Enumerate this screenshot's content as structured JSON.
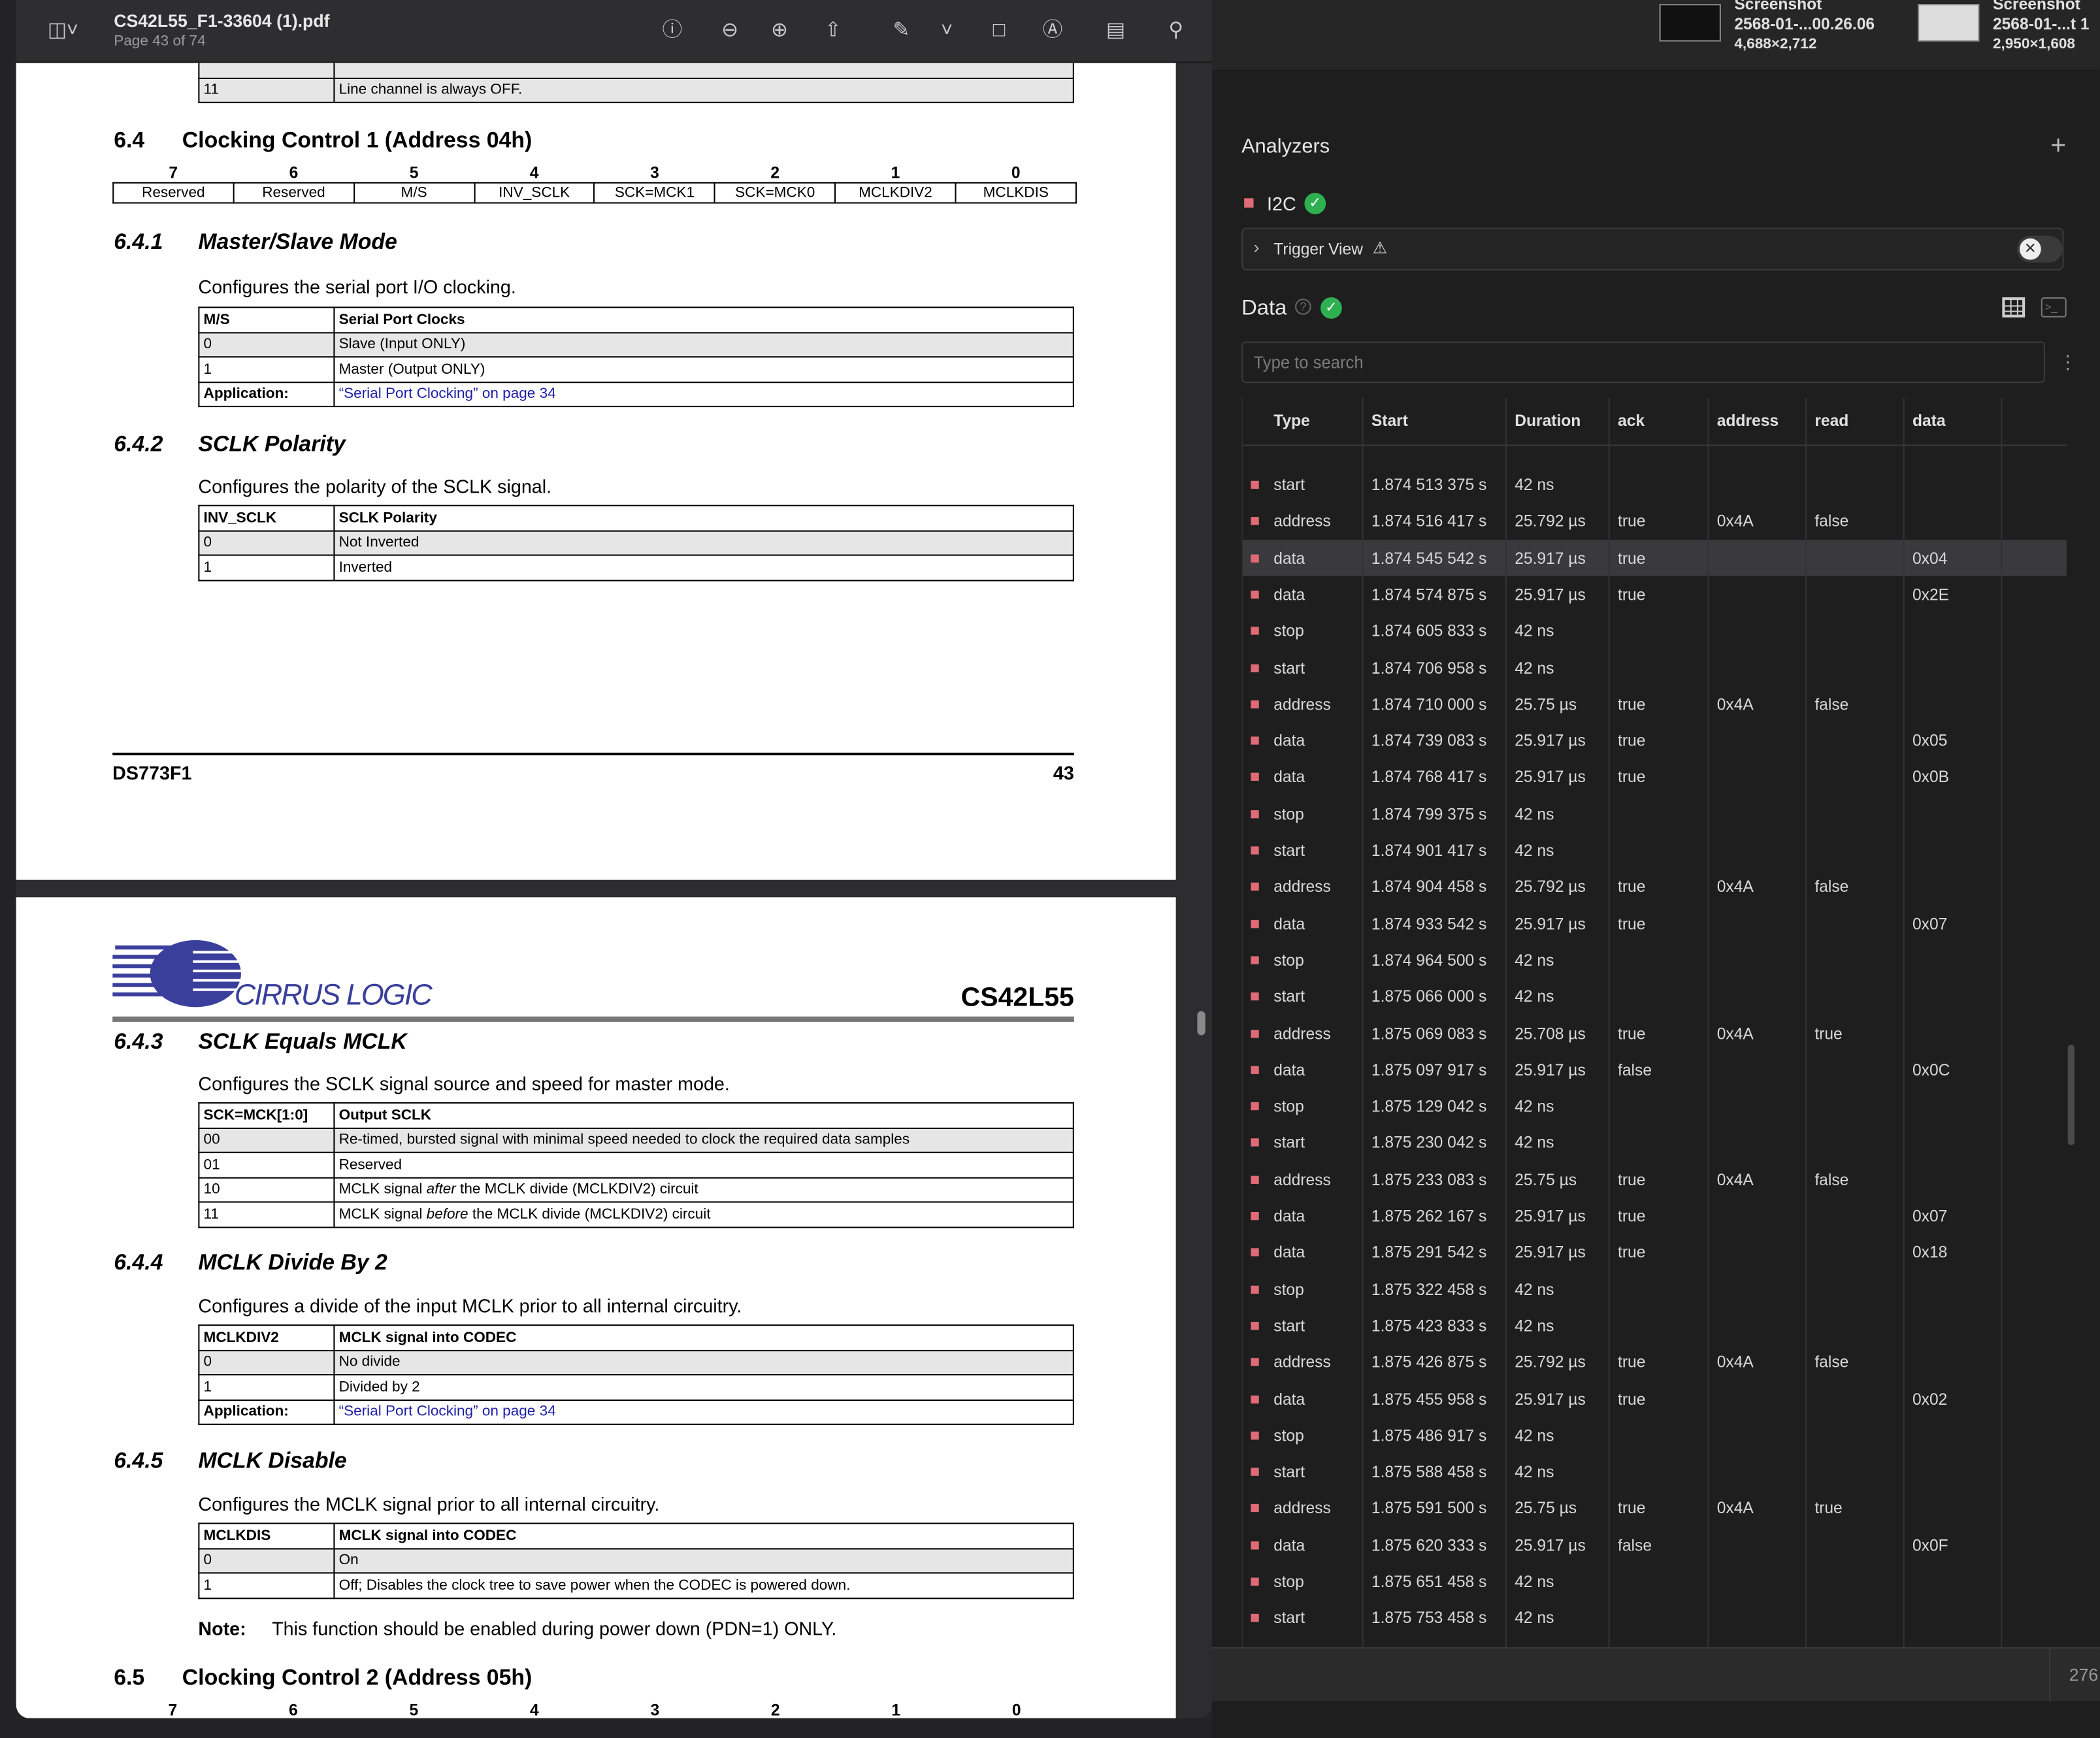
{
  "viewer": {
    "file_name": "CS42L55_F1-33604 (1).pdf",
    "page_label": "Page 43 of 74"
  },
  "pdf": {
    "top_row": {
      "code": "11",
      "text": "Line channel is always OFF."
    },
    "s64": {
      "num": "6.4",
      "title": "Clocking Control 1 (Address 04h)"
    },
    "bits": [
      "7",
      "6",
      "5",
      "4",
      "3",
      "2",
      "1",
      "0"
    ],
    "bit_names": [
      "Reserved",
      "Reserved",
      "M/S",
      "INV_SCLK",
      "SCK=MCK1",
      "SCK=MCK0",
      "MCLKDIV2",
      "MCLKDIS"
    ],
    "s641": {
      "num": "6.4.1",
      "title": "Master/Slave Mode",
      "desc": "Configures the serial port I/O clocking.",
      "h1": "M/S",
      "h2": "Serial Port Clocks",
      "rows": [
        [
          "0",
          "Slave (Input ONLY)"
        ],
        [
          "1",
          "Master (Output ONLY)"
        ]
      ],
      "app_label": "Application:",
      "app_link": "“Serial Port Clocking” on page 34"
    },
    "s642": {
      "num": "6.4.2",
      "title": "SCLK Polarity",
      "desc": "Configures the polarity of the SCLK signal.",
      "h1": "INV_SCLK",
      "h2": "SCLK Polarity",
      "rows": [
        [
          "0",
          "Not Inverted"
        ],
        [
          "1",
          "Inverted"
        ]
      ]
    },
    "footer": {
      "doc": "DS773F1",
      "page": "43"
    },
    "logo": "CIRRUS LOGIC",
    "part": "CS42L55",
    "s643": {
      "num": "6.4.3",
      "title": "SCLK Equals MCLK",
      "desc": "Configures the SCLK signal source and speed for master mode.",
      "h1": "SCK=MCK[1:0]",
      "h2": "Output SCLK",
      "rows": [
        [
          "00",
          "Re-timed, bursted signal with minimal speed needed to clock the required data samples"
        ],
        [
          "01",
          "Reserved"
        ]
      ],
      "r10": {
        "code": "10",
        "a": "MCLK signal ",
        "em": "after",
        "b": " the MCLK divide (MCLKDIV2) circuit"
      },
      "r11": {
        "code": "11",
        "a": "MCLK signal ",
        "em": "before",
        "b": " the MCLK divide (MCLKDIV2) circuit"
      }
    },
    "s644": {
      "num": "6.4.4",
      "title": "MCLK Divide By 2",
      "desc": "Configures a divide of the input MCLK prior to all internal circuitry.",
      "h1": "MCLKDIV2",
      "h2": "MCLK signal into CODEC",
      "rows": [
        [
          "0",
          "No divide"
        ],
        [
          "1",
          "Divided by 2"
        ]
      ],
      "app_label": "Application:",
      "app_link": "“Serial Port Clocking” on page 34"
    },
    "s645": {
      "num": "6.4.5",
      "title": "MCLK Disable",
      "desc": "Configures the MCLK signal prior to all internal circuitry.",
      "h1": "MCLKDIS",
      "h2": "MCLK signal into CODEC",
      "rows": [
        [
          "0",
          "On"
        ],
        [
          "1",
          "Off; Disables the clock tree to save power when the CODEC is powered down."
        ]
      ],
      "note_label": "Note:",
      "note": "This function should be enabled during power down (PDN=1) ONLY."
    },
    "s65": {
      "num": "6.5",
      "title": "Clocking Control 2 (Address 05h)"
    }
  },
  "screenshots": [
    {
      "title": "Screenshot",
      "name": "2568-01-...00.26.06",
      "size": "4,688×2,712"
    },
    {
      "title": "Screenshot",
      "name": "2568-01-...t 1",
      "size": "2,950×1,608"
    }
  ],
  "analyzers": {
    "title": "Analyzers",
    "add": "+",
    "name": "I2C",
    "trigger": "Trigger View",
    "data_title": "Data",
    "search_placeholder": "Type to search",
    "accent": "#e06b76",
    "status_count": "276",
    "columns": [
      "Type",
      "Start",
      "Duration",
      "ack",
      "address",
      "read",
      "data"
    ],
    "rows": [
      [
        "start",
        "1.874 513 375 s",
        "42 ns",
        "",
        "",
        "",
        ""
      ],
      [
        "address",
        "1.874 516 417 s",
        "25.792 µs",
        "true",
        "0x4A",
        "false",
        ""
      ],
      [
        "data",
        "1.874 545 542 s",
        "25.917 µs",
        "true",
        "",
        "",
        "0x04"
      ],
      [
        "data",
        "1.874 574 875 s",
        "25.917 µs",
        "true",
        "",
        "",
        "0x2E"
      ],
      [
        "stop",
        "1.874 605 833 s",
        "42 ns",
        "",
        "",
        "",
        ""
      ],
      [
        "start",
        "1.874 706 958 s",
        "42 ns",
        "",
        "",
        "",
        ""
      ],
      [
        "address",
        "1.874 710 000 s",
        "25.75 µs",
        "true",
        "0x4A",
        "false",
        ""
      ],
      [
        "data",
        "1.874 739 083 s",
        "25.917 µs",
        "true",
        "",
        "",
        "0x05"
      ],
      [
        "data",
        "1.874 768 417 s",
        "25.917 µs",
        "true",
        "",
        "",
        "0x0B"
      ],
      [
        "stop",
        "1.874 799 375 s",
        "42 ns",
        "",
        "",
        "",
        ""
      ],
      [
        "start",
        "1.874 901 417 s",
        "42 ns",
        "",
        "",
        "",
        ""
      ],
      [
        "address",
        "1.874 904 458 s",
        "25.792 µs",
        "true",
        "0x4A",
        "false",
        ""
      ],
      [
        "data",
        "1.874 933 542 s",
        "25.917 µs",
        "true",
        "",
        "",
        "0x07"
      ],
      [
        "stop",
        "1.874 964 500 s",
        "42 ns",
        "",
        "",
        "",
        ""
      ],
      [
        "start",
        "1.875 066 000 s",
        "42 ns",
        "",
        "",
        "",
        ""
      ],
      [
        "address",
        "1.875 069 083 s",
        "25.708 µs",
        "true",
        "0x4A",
        "true",
        ""
      ],
      [
        "data",
        "1.875 097 917 s",
        "25.917 µs",
        "false",
        "",
        "",
        "0x0C"
      ],
      [
        "stop",
        "1.875 129 042 s",
        "42 ns",
        "",
        "",
        "",
        ""
      ],
      [
        "start",
        "1.875 230 042 s",
        "42 ns",
        "",
        "",
        "",
        ""
      ],
      [
        "address",
        "1.875 233 083 s",
        "25.75 µs",
        "true",
        "0x4A",
        "false",
        ""
      ],
      [
        "data",
        "1.875 262 167 s",
        "25.917 µs",
        "true",
        "",
        "",
        "0x07"
      ],
      [
        "data",
        "1.875 291 542 s",
        "25.917 µs",
        "true",
        "",
        "",
        "0x18"
      ],
      [
        "stop",
        "1.875 322 458 s",
        "42 ns",
        "",
        "",
        "",
        ""
      ],
      [
        "start",
        "1.875 423 833 s",
        "42 ns",
        "",
        "",
        "",
        ""
      ],
      [
        "address",
        "1.875 426 875 s",
        "25.792 µs",
        "true",
        "0x4A",
        "false",
        ""
      ],
      [
        "data",
        "1.875 455 958 s",
        "25.917 µs",
        "true",
        "",
        "",
        "0x02"
      ],
      [
        "stop",
        "1.875 486 917 s",
        "42 ns",
        "",
        "",
        "",
        ""
      ],
      [
        "start",
        "1.875 588 458 s",
        "42 ns",
        "",
        "",
        "",
        ""
      ],
      [
        "address",
        "1.875 591 500 s",
        "25.75 µs",
        "true",
        "0x4A",
        "true",
        ""
      ],
      [
        "data",
        "1.875 620 333 s",
        "25.917 µs",
        "false",
        "",
        "",
        "0x0F"
      ],
      [
        "stop",
        "1.875 651 458 s",
        "42 ns",
        "",
        "",
        "",
        ""
      ],
      [
        "start",
        "1.875 753 458 s",
        "42 ns",
        "",
        "",
        "",
        ""
      ]
    ]
  }
}
